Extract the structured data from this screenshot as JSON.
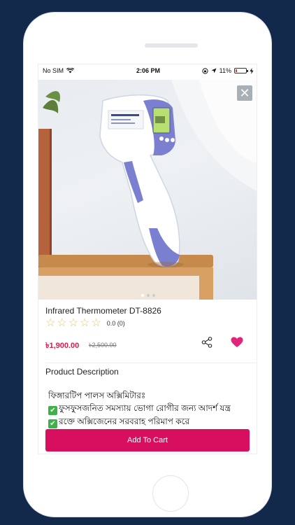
{
  "status_bar": {
    "carrier": "No SIM",
    "time": "2:06 PM",
    "battery": "11%",
    "battery_level": 0.11
  },
  "gallery": {
    "slide_count": 3,
    "active_index": 0,
    "icons": {
      "close": "close-icon"
    },
    "image": "infrared-thermometer-photo"
  },
  "product": {
    "title": "Infrared Thermometer DT-8826",
    "rating": {
      "stars": 5,
      "value": "0.0",
      "count": "(0)"
    },
    "price": "৳1,900.00",
    "old_price": "৳2,500.00",
    "icons": {
      "share": "share-icon",
      "favorite": "heart-icon"
    }
  },
  "description": {
    "heading": "Product Description",
    "lines": [
      "ফিঙ্গারটিপ পালস অক্সিমিটারঃ",
      "ফুসফুসজনিত সমস্যায় ভোগা রোগীর জন্য আদর্শ যন্ত্র",
      "রক্তে অক্সিজেনের সরবরাহ পরিমাপ করে"
    ]
  },
  "actions": {
    "add_to_cart": "Add To Cart"
  },
  "colors": {
    "accent": "#d80e5e",
    "favorite": "#e0257a",
    "background": "#13294b"
  }
}
